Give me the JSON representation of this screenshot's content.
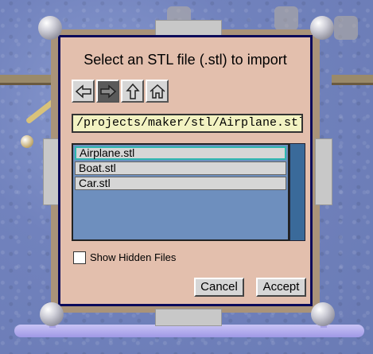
{
  "dialog": {
    "title": "Select an STL file (.stl) to import",
    "path": "/projects/maker/stl/Airplane.stl",
    "nav_icons": [
      "back-arrow-icon",
      "forward-arrow-icon",
      "up-arrow-icon",
      "home-icon"
    ],
    "files": [
      {
        "name": "Airplane.stl",
        "selected": true
      },
      {
        "name": "Boat.stl",
        "selected": false
      },
      {
        "name": "Car.stl",
        "selected": false
      }
    ],
    "show_hidden_label": "Show Hidden Files",
    "show_hidden_checked": false,
    "cancel_label": "Cancel",
    "accept_label": "Accept"
  },
  "colors": {
    "background": "#7182bd",
    "dialog": "#e3bfad",
    "dialog_border": "#0a0a5a",
    "path_field": "#f2f2c2",
    "list_bg": "#6e8fbe",
    "selection_outline": "#2fb6b0"
  }
}
